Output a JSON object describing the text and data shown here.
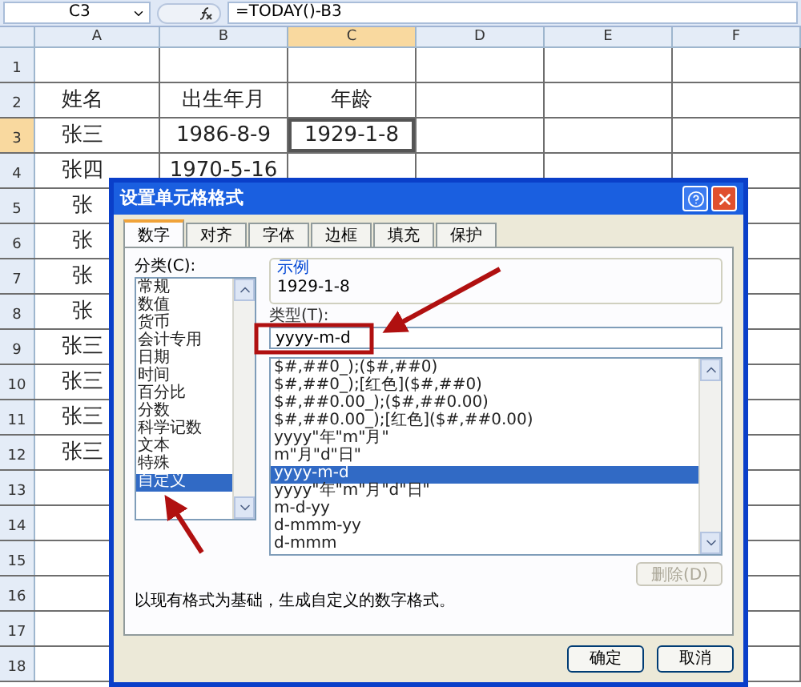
{
  "formula_bar": {
    "name_box": "C3",
    "formula": "=TODAY()-B3"
  },
  "columns": [
    {
      "label": "A",
      "selected": false
    },
    {
      "label": "B",
      "selected": false
    },
    {
      "label": "C",
      "selected": true
    },
    {
      "label": "D",
      "selected": false
    },
    {
      "label": "E",
      "selected": false
    },
    {
      "label": "F",
      "selected": false
    }
  ],
  "rows": [
    {
      "label": "1",
      "selected": false
    },
    {
      "label": "2",
      "selected": false,
      "cells": [
        {
          "text": "姓名",
          "selected": false
        },
        {
          "text": "出生年月",
          "selected": false
        },
        {
          "text": "年龄",
          "selected": false
        }
      ]
    },
    {
      "label": "3",
      "selected": true,
      "cells": [
        {
          "text": "张三",
          "selected": false
        },
        {
          "text": "1986-8-9",
          "selected": false
        },
        {
          "text": "1929-1-8",
          "selected": true
        }
      ]
    },
    {
      "label": "4",
      "selected": false,
      "cells": [
        {
          "text": "张四",
          "selected": false
        },
        {
          "text": "1970-5-16",
          "selected": false
        }
      ]
    },
    {
      "label": "5",
      "selected": false,
      "cells": [
        {
          "text": "张",
          "selected": false
        }
      ]
    },
    {
      "label": "6",
      "selected": false,
      "cells": [
        {
          "text": "张",
          "selected": false
        }
      ]
    },
    {
      "label": "7",
      "selected": false,
      "cells": [
        {
          "text": "张",
          "selected": false
        }
      ]
    },
    {
      "label": "8",
      "selected": false,
      "cells": [
        {
          "text": "张",
          "selected": false
        }
      ]
    },
    {
      "label": "9",
      "selected": false,
      "cells": [
        {
          "text": "张三",
          "selected": false
        }
      ]
    },
    {
      "label": "10",
      "selected": false,
      "cells": [
        {
          "text": "张三",
          "selected": false
        }
      ]
    },
    {
      "label": "11",
      "selected": false,
      "cells": [
        {
          "text": "张三",
          "selected": false
        }
      ]
    },
    {
      "label": "12",
      "selected": false,
      "cells": [
        {
          "text": "张三",
          "selected": false
        }
      ]
    },
    {
      "label": "13",
      "selected": false
    },
    {
      "label": "14",
      "selected": false
    },
    {
      "label": "15",
      "selected": false
    },
    {
      "label": "16",
      "selected": false
    },
    {
      "label": "17",
      "selected": false
    },
    {
      "label": "18",
      "selected": false
    }
  ],
  "dialog": {
    "title": "设置单元格格式",
    "tabs": [
      {
        "label": "数字",
        "selected": true
      },
      {
        "label": "对齐",
        "selected": false
      },
      {
        "label": "字体",
        "selected": false
      },
      {
        "label": "边框",
        "selected": false
      },
      {
        "label": "填充",
        "selected": false
      },
      {
        "label": "保护",
        "selected": false
      }
    ],
    "category_label": "分类(C):",
    "categories": [
      {
        "label": "常规",
        "selected": false
      },
      {
        "label": "数值",
        "selected": false
      },
      {
        "label": "货币",
        "selected": false
      },
      {
        "label": "会计专用",
        "selected": false
      },
      {
        "label": "日期",
        "selected": false
      },
      {
        "label": "时间",
        "selected": false
      },
      {
        "label": "百分比",
        "selected": false
      },
      {
        "label": "分数",
        "selected": false
      },
      {
        "label": "科学记数",
        "selected": false
      },
      {
        "label": "文本",
        "selected": false
      },
      {
        "label": "特殊",
        "selected": false
      },
      {
        "label": "自定义",
        "selected": true
      }
    ],
    "sample_label": "示例",
    "sample_value": "1929-1-8",
    "type_label": "类型(T):",
    "type_value": "yyyy-m-d",
    "formats": [
      {
        "label": "$#,##0_);($#,##0)",
        "selected": false
      },
      {
        "label": "$#,##0_);[红色]($#,##0)",
        "selected": false
      },
      {
        "label": "$#,##0.00_);($#,##0.00)",
        "selected": false
      },
      {
        "label": "$#,##0.00_);[红色]($#,##0.00)",
        "selected": false
      },
      {
        "label": "yyyy\"年\"m\"月\"",
        "selected": false
      },
      {
        "label": "m\"月\"d\"日\"",
        "selected": false
      },
      {
        "label": "yyyy-m-d",
        "selected": true
      },
      {
        "label": "yyyy\"年\"m\"月\"d\"日\"",
        "selected": false
      },
      {
        "label": "m-d-yy",
        "selected": false
      },
      {
        "label": "d-mmm-yy",
        "selected": false
      },
      {
        "label": "d-mmm",
        "selected": false
      }
    ],
    "delete_button": {
      "label": "删除(D)",
      "disabled": true
    },
    "description": "以现有格式为基础，生成自定义的数字格式。",
    "buttons": [
      "确定",
      "取消"
    ]
  }
}
